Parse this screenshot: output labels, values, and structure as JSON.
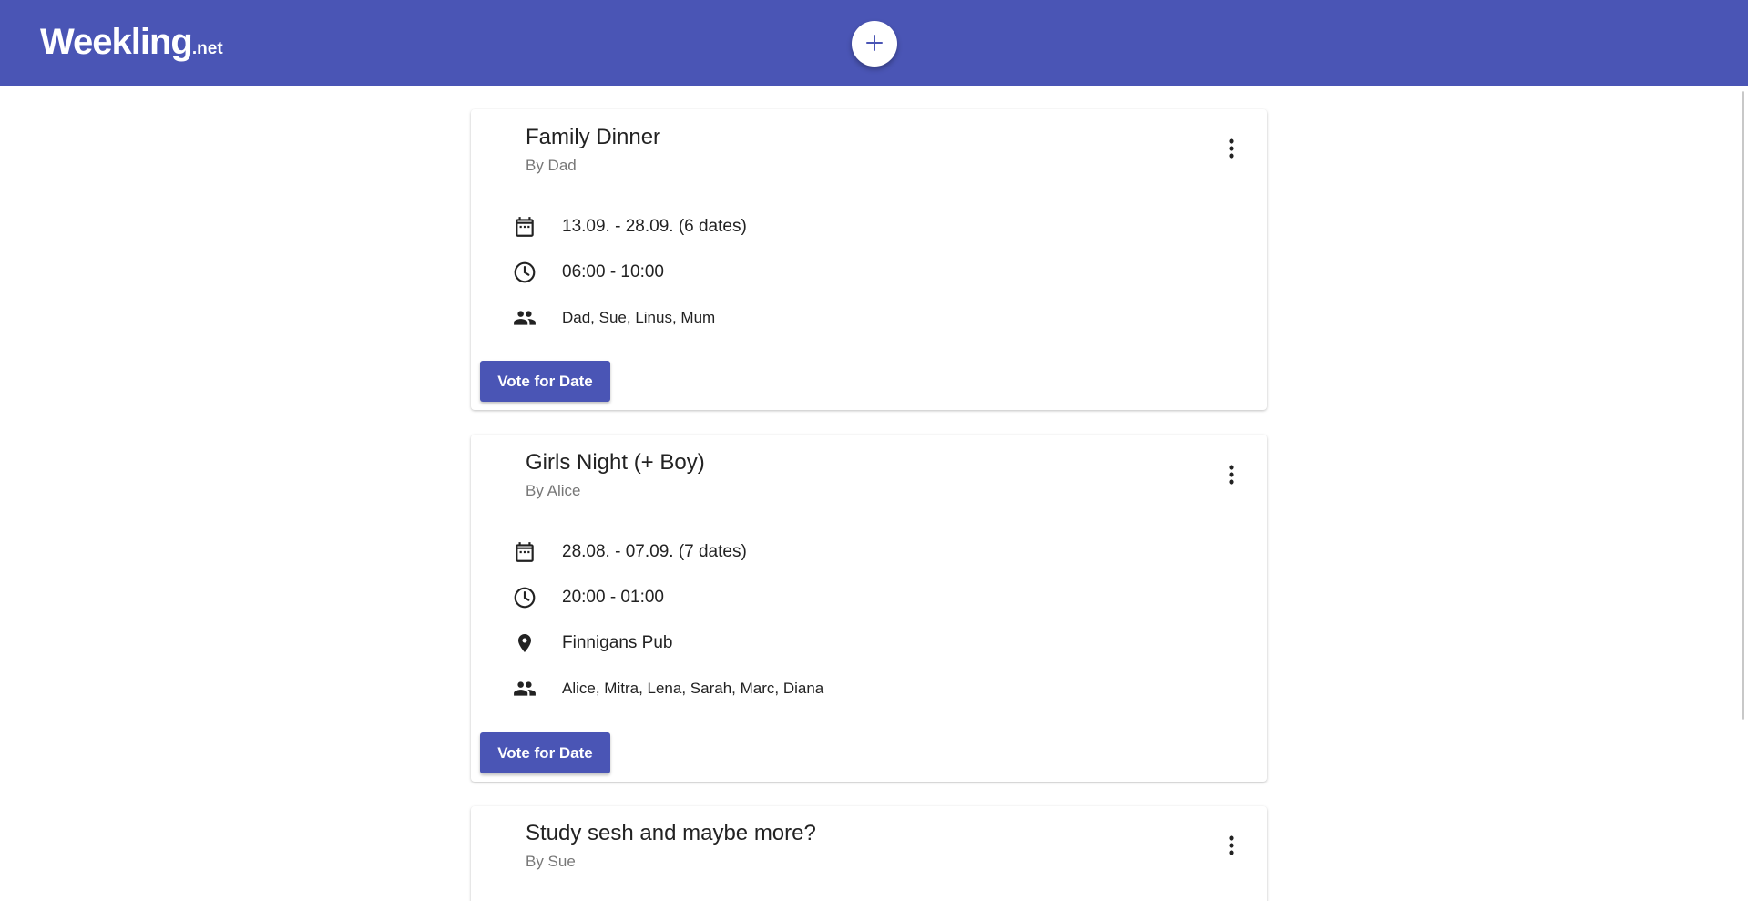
{
  "brand": {
    "name": "Weekling",
    "suffix": ".net"
  },
  "header": {
    "add_button_icon": "plus-icon"
  },
  "colors": {
    "primary": "#4a55b5",
    "title": "#222222",
    "muted": "#777777"
  },
  "events": [
    {
      "title": "Family Dinner",
      "author": "By Dad",
      "dates": "13.09. - 28.09. (6 dates)",
      "time": "06:00 - 10:00",
      "location": null,
      "participants": "Dad, Sue, Linus, Mum",
      "action_label": "Vote for Date"
    },
    {
      "title": "Girls Night (+ Boy)",
      "author": "By Alice",
      "dates": "28.08. - 07.09. (7 dates)",
      "time": "20:00 - 01:00",
      "location": "Finnigans Pub",
      "participants": "Alice, Mitra, Lena, Sarah, Marc, Diana",
      "action_label": "Vote for Date"
    },
    {
      "title": "Study sesh and maybe more?",
      "author": "By Sue"
    }
  ]
}
